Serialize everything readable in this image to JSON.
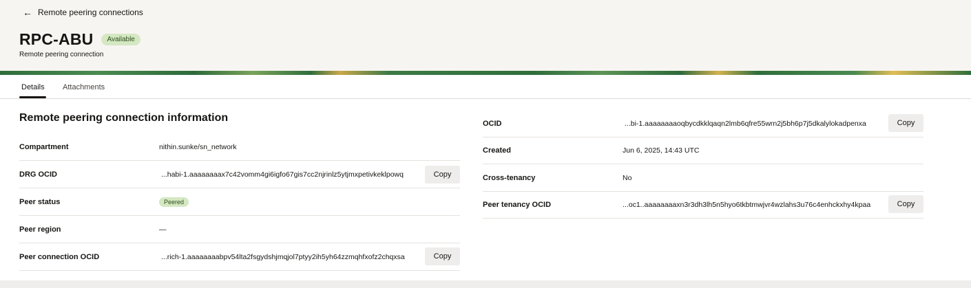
{
  "header": {
    "back_label": "Remote peering connections",
    "title": "RPC-ABU",
    "status_badge": "Available",
    "subtitle": "Remote peering connection"
  },
  "tabs": [
    {
      "label": "Details",
      "active": true
    },
    {
      "label": "Attachments",
      "active": false
    }
  ],
  "section": {
    "title": "Remote peering connection information"
  },
  "left_fields": {
    "compartment": {
      "label": "Compartment",
      "value": "nithin.sunke/sn_network"
    },
    "drg_ocid": {
      "label": "DRG OCID",
      "value": "...habi-1.aaaaaaaax7c42vomm4gi6igfo67gis7cc2njrinlz5ytjmxpetivkeklpowq",
      "copy": "Copy"
    },
    "peer_status": {
      "label": "Peer status",
      "value": "Peered"
    },
    "peer_region": {
      "label": "Peer region",
      "value": "—"
    },
    "peer_connection_ocid": {
      "label": "Peer connection OCID",
      "value": "...rich-1.aaaaaaaabpv54lta2fsgydshjmqjol7ptyy2ih5yh64zzmqhfxofz2chqxsa",
      "copy": "Copy"
    }
  },
  "right_fields": {
    "ocid": {
      "label": "OCID",
      "value": "...bi-1.aaaaaaaaoqbycdkklqaqn2lmb6qfre55wrn2j5bh6p7j5dkalylokadpenxa",
      "copy": "Copy"
    },
    "created": {
      "label": "Created",
      "value": "Jun 6, 2025, 14:43 UTC"
    },
    "cross_tenancy": {
      "label": "Cross-tenancy",
      "value": "No"
    },
    "peer_tenancy_ocid": {
      "label": "Peer tenancy OCID",
      "value": "...oc1..aaaaaaaaxn3r3dh3lh5n5hyo6tkbtmwjvr4wzlahs3u76c4enhckxhy4kpaa",
      "copy": "Copy"
    }
  },
  "colors": {
    "accent_green_badge": "#d4e8c2",
    "header_bg": "#f7f5f2",
    "copy_button_bg": "#eeedeb"
  },
  "icons": {
    "back": "arrow-left-icon"
  }
}
